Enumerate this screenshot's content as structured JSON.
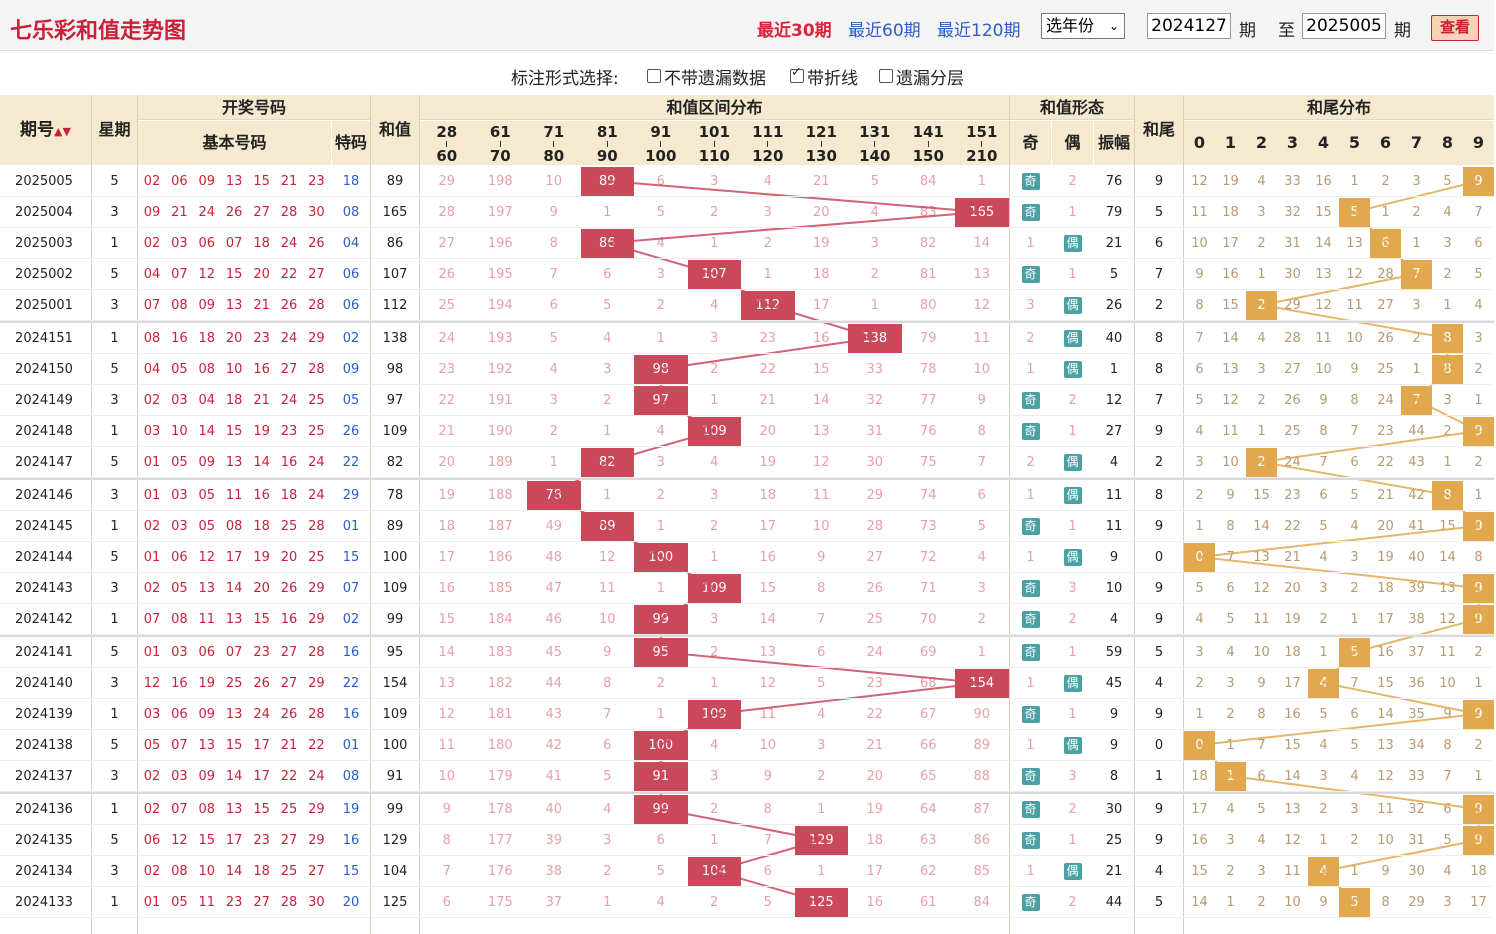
{
  "title": "七乐彩和值走势图",
  "periods": [
    "最近30期",
    "最近60期",
    "最近120期"
  ],
  "year_select": "选年份",
  "issue_from": "2024127",
  "issue_to": "2025005",
  "unit": "期",
  "to_label": "至",
  "view_button": "查看",
  "options": {
    "label": "标注形式选择:",
    "items": [
      {
        "label": "不带遗漏数据",
        "checked": false
      },
      {
        "label": "带折线",
        "checked": true
      },
      {
        "label": "遗漏分层",
        "checked": false
      }
    ]
  },
  "headers": {
    "issue": "期号",
    "week": "星期",
    "draw": "开奖号码",
    "basic": "基本号码",
    "special": "特码",
    "sum": "和值",
    "range_dist": "和值区间分布",
    "form": "和值形态",
    "odd": "奇",
    "even": "偶",
    "amp": "振幅",
    "tail": "和尾",
    "tail_dist": "和尾分布",
    "ranges": [
      [
        "28",
        "60"
      ],
      [
        "61",
        "70"
      ],
      [
        "71",
        "80"
      ],
      [
        "81",
        "90"
      ],
      [
        "91",
        "100"
      ],
      [
        "101",
        "110"
      ],
      [
        "111",
        "120"
      ],
      [
        "121",
        "130"
      ],
      [
        "131",
        "140"
      ],
      [
        "141",
        "150"
      ],
      [
        "151",
        "210"
      ]
    ],
    "tails": [
      "0",
      "1",
      "2",
      "3",
      "4",
      "5",
      "6",
      "7",
      "8",
      "9"
    ]
  },
  "form_labels": {
    "odd": "奇",
    "even": "偶"
  },
  "colors": {
    "hit_sum": "#c9485a",
    "hit_tail": "#e2a84e",
    "badge": "#4ba0a3",
    "title": "#c8223a"
  },
  "rows": [
    {
      "issue": "2025005",
      "week": "5",
      "nums": [
        "02",
        "06",
        "09",
        "13",
        "15",
        "21",
        "23"
      ],
      "sp": "18",
      "sum": "89",
      "ranges": [
        "29",
        "198",
        "10",
        "89",
        "6",
        "3",
        "4",
        "21",
        "5",
        "84",
        "1"
      ],
      "odd": "奇",
      "even": "2",
      "oe": "odd",
      "amp": "76",
      "tail": "9",
      "tails": [
        "12",
        "19",
        "4",
        "33",
        "16",
        "1",
        "2",
        "3",
        "5",
        "9"
      ]
    },
    {
      "issue": "2025004",
      "week": "3",
      "nums": [
        "09",
        "21",
        "24",
        "26",
        "27",
        "28",
        "30"
      ],
      "sp": "08",
      "sum": "165",
      "ranges": [
        "28",
        "197",
        "9",
        "1",
        "5",
        "2",
        "3",
        "20",
        "4",
        "83",
        "165"
      ],
      "odd": "奇",
      "even": "1",
      "oe": "odd",
      "amp": "79",
      "tail": "5",
      "tails": [
        "11",
        "18",
        "3",
        "32",
        "15",
        "5",
        "1",
        "2",
        "4",
        "7"
      ]
    },
    {
      "issue": "2025003",
      "week": "1",
      "nums": [
        "02",
        "03",
        "06",
        "07",
        "18",
        "24",
        "26"
      ],
      "sp": "04",
      "sum": "86",
      "ranges": [
        "27",
        "196",
        "8",
        "86",
        "4",
        "1",
        "2",
        "19",
        "3",
        "82",
        "14"
      ],
      "odd": "1",
      "even": "偶",
      "oe": "even",
      "amp": "21",
      "tail": "6",
      "tails": [
        "10",
        "17",
        "2",
        "31",
        "14",
        "13",
        "6",
        "1",
        "3",
        "6"
      ]
    },
    {
      "issue": "2025002",
      "week": "5",
      "nums": [
        "04",
        "07",
        "12",
        "15",
        "20",
        "22",
        "27"
      ],
      "sp": "06",
      "sum": "107",
      "ranges": [
        "26",
        "195",
        "7",
        "6",
        "3",
        "107",
        "1",
        "18",
        "2",
        "81",
        "13"
      ],
      "odd": "奇",
      "even": "1",
      "oe": "odd",
      "amp": "5",
      "tail": "7",
      "tails": [
        "9",
        "16",
        "1",
        "30",
        "13",
        "12",
        "28",
        "7",
        "2",
        "5"
      ]
    },
    {
      "issue": "2025001",
      "week": "3",
      "nums": [
        "07",
        "08",
        "09",
        "13",
        "21",
        "26",
        "28"
      ],
      "sp": "06",
      "sum": "112",
      "ranges": [
        "25",
        "194",
        "6",
        "5",
        "2",
        "4",
        "112",
        "17",
        "1",
        "80",
        "12"
      ],
      "odd": "3",
      "even": "偶",
      "oe": "even",
      "amp": "26",
      "tail": "2",
      "tails": [
        "8",
        "15",
        "2",
        "29",
        "12",
        "11",
        "27",
        "3",
        "1",
        "4"
      ]
    },
    {
      "issue": "2024151",
      "week": "1",
      "nums": [
        "08",
        "16",
        "18",
        "20",
        "23",
        "24",
        "29"
      ],
      "sp": "02",
      "sum": "138",
      "ranges": [
        "24",
        "193",
        "5",
        "4",
        "1",
        "3",
        "23",
        "16",
        "138",
        "79",
        "11"
      ],
      "odd": "2",
      "even": "偶",
      "oe": "even",
      "amp": "40",
      "tail": "8",
      "tails": [
        "7",
        "14",
        "4",
        "28",
        "11",
        "10",
        "26",
        "2",
        "8",
        "3"
      ]
    },
    {
      "issue": "2024150",
      "week": "5",
      "nums": [
        "04",
        "05",
        "08",
        "10",
        "16",
        "27",
        "28"
      ],
      "sp": "09",
      "sum": "98",
      "ranges": [
        "23",
        "192",
        "4",
        "3",
        "98",
        "2",
        "22",
        "15",
        "33",
        "78",
        "10"
      ],
      "odd": "1",
      "even": "偶",
      "oe": "even",
      "amp": "1",
      "tail": "8",
      "tails": [
        "6",
        "13",
        "3",
        "27",
        "10",
        "9",
        "25",
        "1",
        "8",
        "2"
      ]
    },
    {
      "issue": "2024149",
      "week": "3",
      "nums": [
        "02",
        "03",
        "04",
        "18",
        "21",
        "24",
        "25"
      ],
      "sp": "05",
      "sum": "97",
      "ranges": [
        "22",
        "191",
        "3",
        "2",
        "97",
        "1",
        "21",
        "14",
        "32",
        "77",
        "9"
      ],
      "odd": "奇",
      "even": "2",
      "oe": "odd",
      "amp": "12",
      "tail": "7",
      "tails": [
        "5",
        "12",
        "2",
        "26",
        "9",
        "8",
        "24",
        "7",
        "3",
        "1"
      ]
    },
    {
      "issue": "2024148",
      "week": "1",
      "nums": [
        "03",
        "10",
        "14",
        "15",
        "19",
        "23",
        "25"
      ],
      "sp": "26",
      "sum": "109",
      "ranges": [
        "21",
        "190",
        "2",
        "1",
        "4",
        "109",
        "20",
        "13",
        "31",
        "76",
        "8"
      ],
      "odd": "奇",
      "even": "1",
      "oe": "odd",
      "amp": "27",
      "tail": "9",
      "tails": [
        "4",
        "11",
        "1",
        "25",
        "8",
        "7",
        "23",
        "44",
        "2",
        "9"
      ]
    },
    {
      "issue": "2024147",
      "week": "5",
      "nums": [
        "01",
        "05",
        "09",
        "13",
        "14",
        "16",
        "24"
      ],
      "sp": "22",
      "sum": "82",
      "ranges": [
        "20",
        "189",
        "1",
        "82",
        "3",
        "4",
        "19",
        "12",
        "30",
        "75",
        "7"
      ],
      "odd": "2",
      "even": "偶",
      "oe": "even",
      "amp": "4",
      "tail": "2",
      "tails": [
        "3",
        "10",
        "2",
        "24",
        "7",
        "6",
        "22",
        "43",
        "1",
        "2"
      ]
    },
    {
      "issue": "2024146",
      "week": "3",
      "nums": [
        "01",
        "03",
        "05",
        "11",
        "16",
        "18",
        "24"
      ],
      "sp": "29",
      "sum": "78",
      "ranges": [
        "19",
        "188",
        "78",
        "1",
        "2",
        "3",
        "18",
        "11",
        "29",
        "74",
        "6"
      ],
      "odd": "1",
      "even": "偶",
      "oe": "even",
      "amp": "11",
      "tail": "8",
      "tails": [
        "2",
        "9",
        "15",
        "23",
        "6",
        "5",
        "21",
        "42",
        "8",
        "1"
      ]
    },
    {
      "issue": "2024145",
      "week": "1",
      "nums": [
        "02",
        "03",
        "05",
        "08",
        "18",
        "25",
        "28"
      ],
      "sp": "01",
      "sum": "89",
      "ranges": [
        "18",
        "187",
        "49",
        "89",
        "1",
        "2",
        "17",
        "10",
        "28",
        "73",
        "5"
      ],
      "odd": "奇",
      "even": "1",
      "oe": "odd",
      "amp": "11",
      "tail": "9",
      "tails": [
        "1",
        "8",
        "14",
        "22",
        "5",
        "4",
        "20",
        "41",
        "15",
        "9"
      ]
    },
    {
      "issue": "2024144",
      "week": "5",
      "nums": [
        "01",
        "06",
        "12",
        "17",
        "19",
        "20",
        "25"
      ],
      "sp": "15",
      "sum": "100",
      "ranges": [
        "17",
        "186",
        "48",
        "12",
        "100",
        "1",
        "16",
        "9",
        "27",
        "72",
        "4"
      ],
      "odd": "1",
      "even": "偶",
      "oe": "even",
      "amp": "9",
      "tail": "0",
      "tails": [
        "0",
        "7",
        "13",
        "21",
        "4",
        "3",
        "19",
        "40",
        "14",
        "8"
      ]
    },
    {
      "issue": "2024143",
      "week": "3",
      "nums": [
        "02",
        "05",
        "13",
        "14",
        "20",
        "26",
        "29"
      ],
      "sp": "07",
      "sum": "109",
      "ranges": [
        "16",
        "185",
        "47",
        "11",
        "1",
        "109",
        "15",
        "8",
        "26",
        "71",
        "3"
      ],
      "odd": "奇",
      "even": "3",
      "oe": "odd",
      "amp": "10",
      "tail": "9",
      "tails": [
        "5",
        "6",
        "12",
        "20",
        "3",
        "2",
        "18",
        "39",
        "13",
        "9"
      ]
    },
    {
      "issue": "2024142",
      "week": "1",
      "nums": [
        "07",
        "08",
        "11",
        "13",
        "15",
        "16",
        "29"
      ],
      "sp": "02",
      "sum": "99",
      "ranges": [
        "15",
        "184",
        "46",
        "10",
        "99",
        "3",
        "14",
        "7",
        "25",
        "70",
        "2"
      ],
      "odd": "奇",
      "even": "2",
      "oe": "odd",
      "amp": "4",
      "tail": "9",
      "tails": [
        "4",
        "5",
        "11",
        "19",
        "2",
        "1",
        "17",
        "38",
        "12",
        "9"
      ]
    },
    {
      "issue": "2024141",
      "week": "5",
      "nums": [
        "01",
        "03",
        "06",
        "07",
        "23",
        "27",
        "28"
      ],
      "sp": "16",
      "sum": "95",
      "ranges": [
        "14",
        "183",
        "45",
        "9",
        "95",
        "2",
        "13",
        "6",
        "24",
        "69",
        "1"
      ],
      "odd": "奇",
      "even": "1",
      "oe": "odd",
      "amp": "59",
      "tail": "5",
      "tails": [
        "3",
        "4",
        "10",
        "18",
        "1",
        "5",
        "16",
        "37",
        "11",
        "2"
      ]
    },
    {
      "issue": "2024140",
      "week": "3",
      "nums": [
        "12",
        "16",
        "19",
        "25",
        "26",
        "27",
        "29"
      ],
      "sp": "22",
      "sum": "154",
      "ranges": [
        "13",
        "182",
        "44",
        "8",
        "2",
        "1",
        "12",
        "5",
        "23",
        "68",
        "154"
      ],
      "odd": "1",
      "even": "偶",
      "oe": "even",
      "amp": "45",
      "tail": "4",
      "tails": [
        "2",
        "3",
        "9",
        "17",
        "4",
        "7",
        "15",
        "36",
        "10",
        "1"
      ]
    },
    {
      "issue": "2024139",
      "week": "1",
      "nums": [
        "03",
        "06",
        "09",
        "13",
        "24",
        "26",
        "28"
      ],
      "sp": "16",
      "sum": "109",
      "ranges": [
        "12",
        "181",
        "43",
        "7",
        "1",
        "109",
        "11",
        "4",
        "22",
        "67",
        "90"
      ],
      "odd": "奇",
      "even": "1",
      "oe": "odd",
      "amp": "9",
      "tail": "9",
      "tails": [
        "1",
        "2",
        "8",
        "16",
        "5",
        "6",
        "14",
        "35",
        "9",
        "9"
      ]
    },
    {
      "issue": "2024138",
      "week": "5",
      "nums": [
        "05",
        "07",
        "13",
        "15",
        "17",
        "21",
        "22"
      ],
      "sp": "01",
      "sum": "100",
      "ranges": [
        "11",
        "180",
        "42",
        "6",
        "100",
        "4",
        "10",
        "3",
        "21",
        "66",
        "89"
      ],
      "odd": "1",
      "even": "偶",
      "oe": "even",
      "amp": "9",
      "tail": "0",
      "tails": [
        "0",
        "1",
        "7",
        "15",
        "4",
        "5",
        "13",
        "34",
        "8",
        "2"
      ]
    },
    {
      "issue": "2024137",
      "week": "3",
      "nums": [
        "02",
        "03",
        "09",
        "14",
        "17",
        "22",
        "24"
      ],
      "sp": "08",
      "sum": "91",
      "ranges": [
        "10",
        "179",
        "41",
        "5",
        "91",
        "3",
        "9",
        "2",
        "20",
        "65",
        "88"
      ],
      "odd": "奇",
      "even": "3",
      "oe": "odd",
      "amp": "8",
      "tail": "1",
      "tails": [
        "18",
        "1",
        "6",
        "14",
        "3",
        "4",
        "12",
        "33",
        "7",
        "1"
      ]
    },
    {
      "issue": "2024136",
      "week": "1",
      "nums": [
        "02",
        "07",
        "08",
        "13",
        "15",
        "25",
        "29"
      ],
      "sp": "19",
      "sum": "99",
      "ranges": [
        "9",
        "178",
        "40",
        "4",
        "99",
        "2",
        "8",
        "1",
        "19",
        "64",
        "87"
      ],
      "odd": "奇",
      "even": "2",
      "oe": "odd",
      "amp": "30",
      "tail": "9",
      "tails": [
        "17",
        "4",
        "5",
        "13",
        "2",
        "3",
        "11",
        "32",
        "6",
        "9"
      ]
    },
    {
      "issue": "2024135",
      "week": "5",
      "nums": [
        "06",
        "12",
        "15",
        "17",
        "23",
        "27",
        "29"
      ],
      "sp": "16",
      "sum": "129",
      "ranges": [
        "8",
        "177",
        "39",
        "3",
        "6",
        "1",
        "7",
        "129",
        "18",
        "63",
        "86"
      ],
      "odd": "奇",
      "even": "1",
      "oe": "odd",
      "amp": "25",
      "tail": "9",
      "tails": [
        "16",
        "3",
        "4",
        "12",
        "1",
        "2",
        "10",
        "31",
        "5",
        "9"
      ]
    },
    {
      "issue": "2024134",
      "week": "3",
      "nums": [
        "02",
        "08",
        "10",
        "14",
        "18",
        "25",
        "27"
      ],
      "sp": "15",
      "sum": "104",
      "ranges": [
        "7",
        "176",
        "38",
        "2",
        "5",
        "104",
        "6",
        "1",
        "17",
        "62",
        "85"
      ],
      "odd": "1",
      "even": "偶",
      "oe": "even",
      "amp": "21",
      "tail": "4",
      "tails": [
        "15",
        "2",
        "3",
        "11",
        "4",
        "1",
        "9",
        "30",
        "4",
        "18"
      ]
    },
    {
      "issue": "2024133",
      "week": "1",
      "nums": [
        "01",
        "05",
        "11",
        "23",
        "27",
        "28",
        "30"
      ],
      "sp": "20",
      "sum": "125",
      "ranges": [
        "6",
        "175",
        "37",
        "1",
        "4",
        "2",
        "5",
        "125",
        "16",
        "61",
        "84"
      ],
      "odd": "奇",
      "even": "2",
      "oe": "odd",
      "amp": "44",
      "tail": "5",
      "tails": [
        "14",
        "1",
        "2",
        "10",
        "9",
        "5",
        "8",
        "29",
        "3",
        "17"
      ]
    }
  ]
}
